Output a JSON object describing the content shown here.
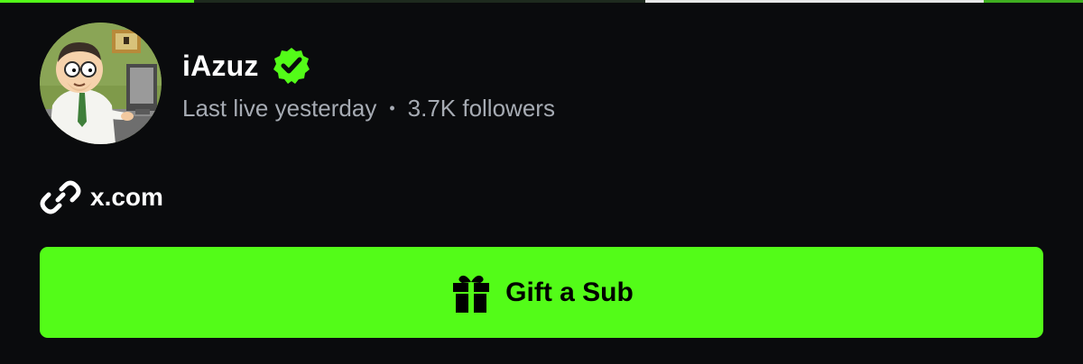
{
  "top_bar": {
    "colors": {
      "accent": "#53fc18",
      "highlight": "#e8e8e8"
    }
  },
  "profile": {
    "avatar_icon": "avatar-image",
    "username": "iAzuz",
    "verified_icon": "verified-badge-icon",
    "last_live": "Last live yesterday",
    "separator": "•",
    "followers": "3.7K followers"
  },
  "links": {
    "icon": "link-icon",
    "label": "x.com"
  },
  "actions": {
    "gift_icon": "gift-icon",
    "gift_label": "Gift a Sub"
  },
  "colors": {
    "background": "#0a0b0d",
    "accent": "#53fc18",
    "text_primary": "#ffffff",
    "text_secondary": "#a6abb3",
    "button_text": "#000000"
  }
}
